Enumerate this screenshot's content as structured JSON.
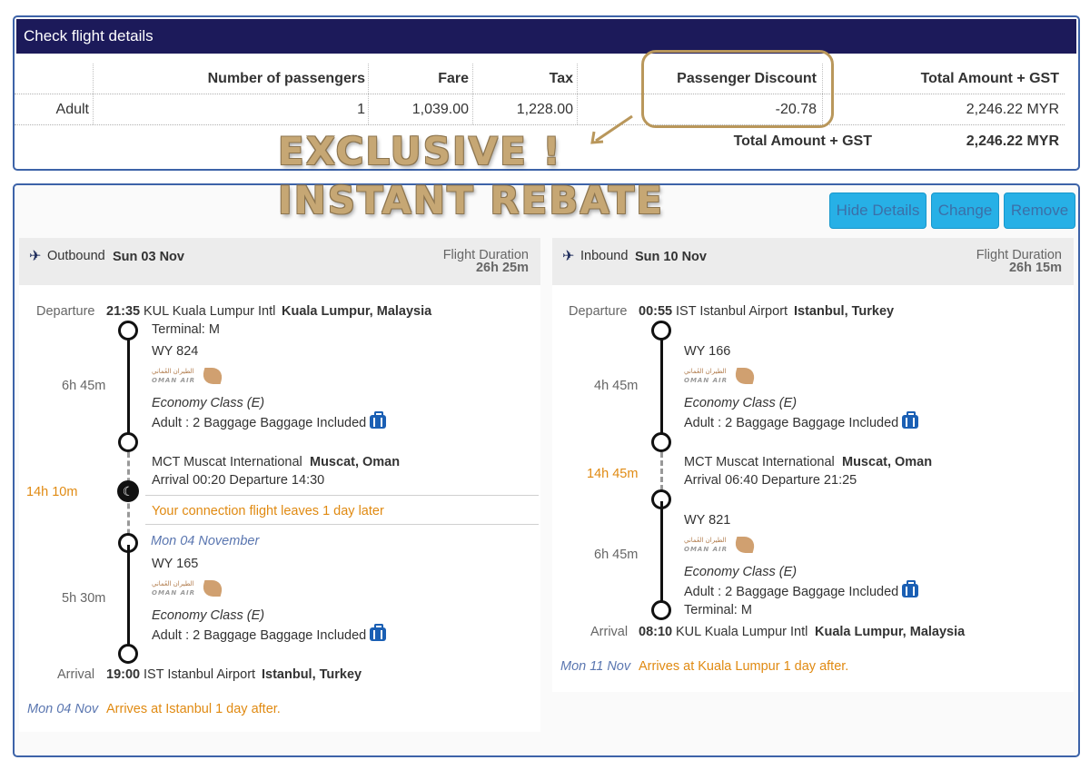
{
  "fare_panel": {
    "title": "Check flight details",
    "columns": [
      "Number of passengers",
      "Fare",
      "Tax",
      "Passenger Discount",
      "Total Amount + GST"
    ],
    "rows": [
      {
        "type": "Adult",
        "passengers": "1",
        "fare": "1,039.00",
        "tax": "1,228.00",
        "discount": "-20.78",
        "total": "2,246.22 MYR"
      }
    ],
    "grand_total_label": "Total Amount + GST",
    "grand_total_value": "2,246.22 MYR"
  },
  "promo": {
    "line1": "EXCLUSIVE !",
    "line2": "INSTANT REBATE"
  },
  "actions": {
    "hide_details": "Hide Details",
    "change": "Change",
    "remove": "Remove"
  },
  "outbound": {
    "direction": "Outbound",
    "date": "Sun 03 Nov",
    "duration_label": "Flight Duration",
    "duration": "26h 25m",
    "departure_label": "Departure",
    "departure_time": "21:35",
    "departure_airport": "KUL Kuala Lumpur Intl",
    "departure_city": "Kuala Lumpur, Malaysia",
    "terminal": "Terminal: M",
    "seg1": {
      "flight": "WY 824",
      "duration": "6h 45m",
      "class": "Economy Class (E)",
      "baggage": "Adult : 2 Baggage Baggage Included"
    },
    "stop": {
      "airport": "MCT Muscat International",
      "city": "Muscat, Oman",
      "times": "Arrival 00:20 Departure 14:30",
      "layover": "14h 10m",
      "notice": "Your connection flight leaves 1 day later",
      "next_date": "Mon 04 November"
    },
    "seg2": {
      "flight": "WY 165",
      "duration": "5h 30m",
      "class": "Economy Class (E)",
      "baggage": "Adult : 2 Baggage Baggage Included"
    },
    "arrival_label": "Arrival",
    "arrival_time": "19:00",
    "arrival_airport": "IST Istanbul Airport",
    "arrival_city": "Istanbul, Turkey",
    "footer_date": "Mon 04 Nov",
    "footer_note": "Arrives at Istanbul 1 day after."
  },
  "inbound": {
    "direction": "Inbound",
    "date": "Sun 10 Nov",
    "duration_label": "Flight Duration",
    "duration": "26h 15m",
    "departure_label": "Departure",
    "departure_time": "00:55",
    "departure_airport": "IST Istanbul Airport",
    "departure_city": "Istanbul, Turkey",
    "seg1": {
      "flight": "WY 166",
      "duration": "4h 45m",
      "class": "Economy Class (E)",
      "baggage": "Adult : 2 Baggage Baggage Included"
    },
    "stop": {
      "airport": "MCT Muscat International",
      "city": "Muscat, Oman",
      "times": "Arrival 06:40 Departure 21:25",
      "layover": "14h 45m"
    },
    "seg2": {
      "flight": "WY 821",
      "duration": "6h 45m",
      "class": "Economy Class (E)",
      "baggage": "Adult : 2 Baggage Baggage Included",
      "terminal": "Terminal: M"
    },
    "arrival_label": "Arrival",
    "arrival_time": "08:10",
    "arrival_airport": "KUL Kuala Lumpur Intl",
    "arrival_city": "Kuala Lumpur, Malaysia",
    "footer_date": "Mon 11 Nov",
    "footer_note": "Arrives at Kuala Lumpur 1 day after."
  },
  "airline_logo": {
    "arabic": "الطيران العُماني",
    "english": "OMAN AIR"
  },
  "colors": {
    "header": "#1c1a5a",
    "button": "#27b0e6",
    "accent_orange": "#e08a12",
    "promo_gold": "#c6a774"
  },
  "icons": {
    "plane": "plane-icon",
    "moon": "moon-icon",
    "baggage": "suitcase-icon"
  }
}
